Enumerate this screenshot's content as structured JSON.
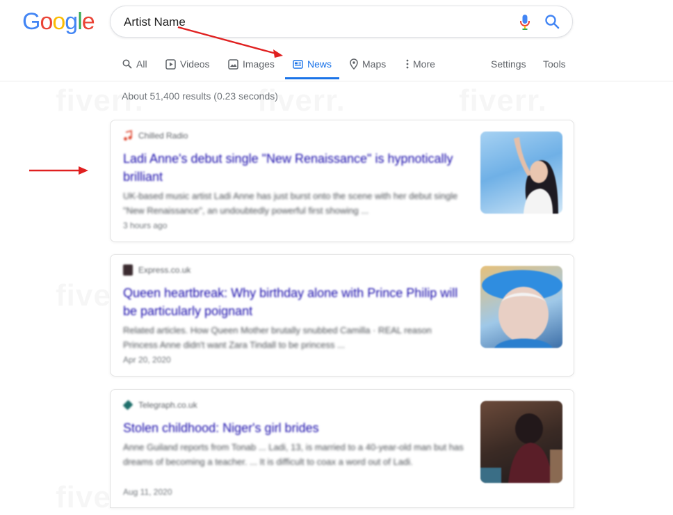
{
  "logo": {
    "letters": [
      "G",
      "o",
      "o",
      "g",
      "l",
      "e"
    ],
    "colors": [
      "#4285F4",
      "#EA4335",
      "#FBBC05",
      "#4285F4",
      "#34A853",
      "#EA4335"
    ]
  },
  "search": {
    "value": "Artist Name",
    "mic_icon": "mic-icon",
    "search_icon": "magnifier-icon"
  },
  "tabs": {
    "all": "All",
    "videos": "Videos",
    "images": "Images",
    "news": "News",
    "maps": "Maps",
    "more": "More",
    "settings": "Settings",
    "tools": "Tools",
    "active": "News",
    "accent": "#1a73e8"
  },
  "stats": "About 51,400 results (0.23 seconds)",
  "results": [
    {
      "source": "Chilled Radio",
      "headline": "Ladi Anne's debut single \"New Renaissance\" is hypnotically brilliant",
      "snippet": "UK-based music artist Ladi Anne has just burst onto the scene with her debut single \"New Renaissance\", an undoubtedly powerful first showing ...",
      "date": "3 hours ago"
    },
    {
      "source": "Express.co.uk",
      "headline": "Queen heartbreak: Why birthday alone with Prince Philip will be particularly poignant",
      "snippet": "Related articles. How Queen Mother brutally snubbed Camilla · REAL reason Princess Anne didn't want Zara Tindall to be princess ...",
      "date": "Apr 20, 2020"
    },
    {
      "source": "Telegraph.co.uk",
      "headline": "Stolen childhood: Niger's girl brides",
      "snippet": "Anne Guiland reports from Tonab ... Ladi, 13, is married to a 40-year-old man but has dreams of becoming a teacher. ... It is difficult to coax a word out of Ladi.",
      "date": "Aug 11, 2020"
    }
  ],
  "annotation_color": "#e02020"
}
